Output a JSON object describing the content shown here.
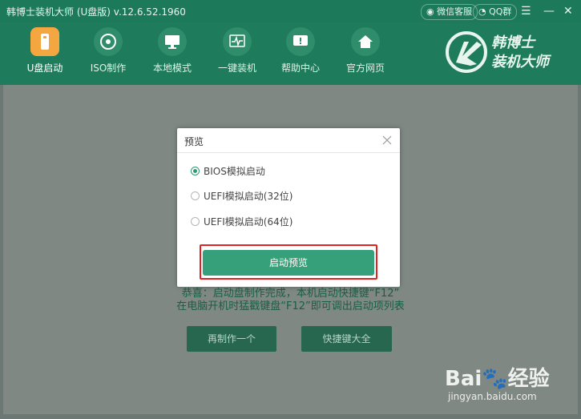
{
  "window": {
    "title": "韩博士装机大师 (U盘版) v.12.6.52.1960",
    "wechat_label": "微信客服",
    "qq_label": "QQ群"
  },
  "nav": {
    "items": [
      {
        "label": "U盘启动",
        "icon": "usb-icon",
        "active": true
      },
      {
        "label": "ISO制作",
        "icon": "disc-icon",
        "active": false
      },
      {
        "label": "本地模式",
        "icon": "monitor-icon",
        "active": false
      },
      {
        "label": "一键装机",
        "icon": "pulse-icon",
        "active": false
      },
      {
        "label": "帮助中心",
        "icon": "help-icon",
        "active": false
      },
      {
        "label": "官方网页",
        "icon": "home-icon",
        "active": false
      }
    ]
  },
  "brand": {
    "line1": "韩博士",
    "line2": "装机大师"
  },
  "background": {
    "line1": "恭喜：启动盘制作完成，本机启动快捷键“F12”",
    "line2": "在电脑开机时猛戳键盘“F12”即可调出启动项列表",
    "remake_button": "再制作一个",
    "shortcut_button": "快捷键大全"
  },
  "dialog": {
    "title": "预览",
    "options": [
      {
        "label": "BIOS模拟启动",
        "selected": true
      },
      {
        "label": "UEFI模拟启动(32位)",
        "selected": false
      },
      {
        "label": "UEFI模拟启动(64位)",
        "selected": false
      }
    ],
    "start_button": "启动预览"
  },
  "watermark": {
    "brand": "Bai",
    "brand2": "经验",
    "url": "jingyan.baidu.com"
  },
  "colors": {
    "accent": "#36a07a",
    "active_nav": "#f4a640",
    "highlight": "#e32121"
  }
}
